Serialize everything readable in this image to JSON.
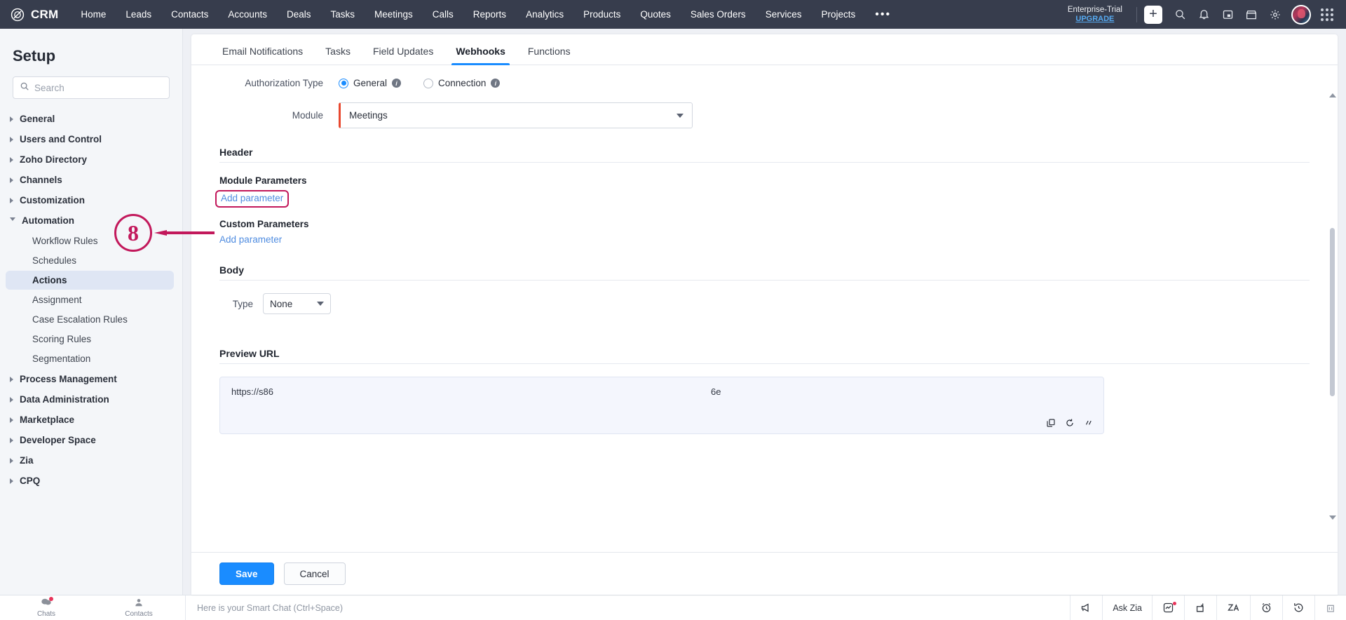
{
  "topnav": {
    "brand": "CRM",
    "items": [
      "Home",
      "Leads",
      "Contacts",
      "Accounts",
      "Deals",
      "Tasks",
      "Meetings",
      "Calls",
      "Reports",
      "Analytics",
      "Products",
      "Quotes",
      "Sales Orders",
      "Services",
      "Projects"
    ],
    "more": "•••",
    "trial_label": "Enterprise-Trial",
    "upgrade_label": "UPGRADE",
    "icons": [
      "plus-icon",
      "search-icon",
      "bell-icon",
      "calendar-icon",
      "marketplace-icon",
      "gear-icon",
      "avatar",
      "app-grid-icon"
    ],
    "bg_color": "#373d4d",
    "upgrade_color": "#56a9f0"
  },
  "sidebar": {
    "title": "Setup",
    "search_placeholder": "Search",
    "search_value": "",
    "groups": [
      {
        "label": "General",
        "expanded": false
      },
      {
        "label": "Users and Control",
        "expanded": false
      },
      {
        "label": "Zoho Directory",
        "expanded": false
      },
      {
        "label": "Channels",
        "expanded": false
      },
      {
        "label": "Customization",
        "expanded": false
      },
      {
        "label": "Automation",
        "expanded": true
      }
    ],
    "automation_children": [
      {
        "label": "Workflow Rules",
        "active": false
      },
      {
        "label": "Schedules",
        "active": false
      },
      {
        "label": "Actions",
        "active": true
      },
      {
        "label": "Assignment",
        "active": false
      },
      {
        "label": "Case Escalation Rules",
        "active": false
      },
      {
        "label": "Scoring Rules",
        "active": false
      },
      {
        "label": "Segmentation",
        "active": false
      }
    ],
    "groups_after": [
      {
        "label": "Process Management"
      },
      {
        "label": "Data Administration"
      },
      {
        "label": "Marketplace"
      },
      {
        "label": "Developer Space"
      },
      {
        "label": "Zia"
      },
      {
        "label": "CPQ"
      }
    ]
  },
  "main": {
    "tabs": [
      {
        "label": "Email Notifications",
        "active": false
      },
      {
        "label": "Tasks",
        "active": false
      },
      {
        "label": "Field Updates",
        "active": false
      },
      {
        "label": "Webhooks",
        "active": true
      },
      {
        "label": "Functions",
        "active": false
      }
    ],
    "authorization": {
      "label": "Authorization Type",
      "options": [
        {
          "label": "General",
          "selected": true
        },
        {
          "label": "Connection",
          "selected": false
        }
      ],
      "info_icon": "info-icon"
    },
    "module": {
      "label": "Module",
      "value": "Meetings",
      "required_marker_color": "#e8482f"
    },
    "header_section": {
      "title": "Header",
      "module_parameters_label": "Module Parameters",
      "module_add_link": "Add parameter",
      "custom_parameters_label": "Custom Parameters",
      "custom_add_link": "Add parameter"
    },
    "body_section": {
      "title": "Body",
      "type_label": "Type",
      "type_value": "None"
    },
    "preview_section": {
      "title": "Preview URL",
      "url_text": "https://s86",
      "url_fragment": "6e",
      "icons": [
        "copy-icon",
        "refresh-icon",
        "expand-icon"
      ]
    },
    "footer": {
      "save_label": "Save",
      "cancel_label": "Cancel",
      "save_color": "#1a8cff"
    }
  },
  "annotation": {
    "step_number": "8",
    "color": "#c2185b",
    "target": "Add parameter"
  },
  "bottombar": {
    "tiles": [
      {
        "label": "Chats",
        "icon": "chat-icon",
        "badge": true
      },
      {
        "label": "Contacts",
        "icon": "contact-icon",
        "badge": false
      }
    ],
    "chat_placeholder": "Here is your Smart Chat (Ctrl+Space)",
    "right_items": [
      {
        "label": "",
        "icon": "megaphone-icon"
      },
      {
        "label": "Ask Zia",
        "icon": ""
      },
      {
        "label": "",
        "icon": "analytics-icon",
        "badge": true
      },
      {
        "label": "",
        "icon": "note-icon"
      },
      {
        "label": "",
        "icon": "zia-icon"
      },
      {
        "label": "",
        "icon": "alarm-icon"
      },
      {
        "label": "",
        "icon": "history-icon"
      },
      {
        "label": "",
        "icon": "trash-icon"
      }
    ]
  }
}
